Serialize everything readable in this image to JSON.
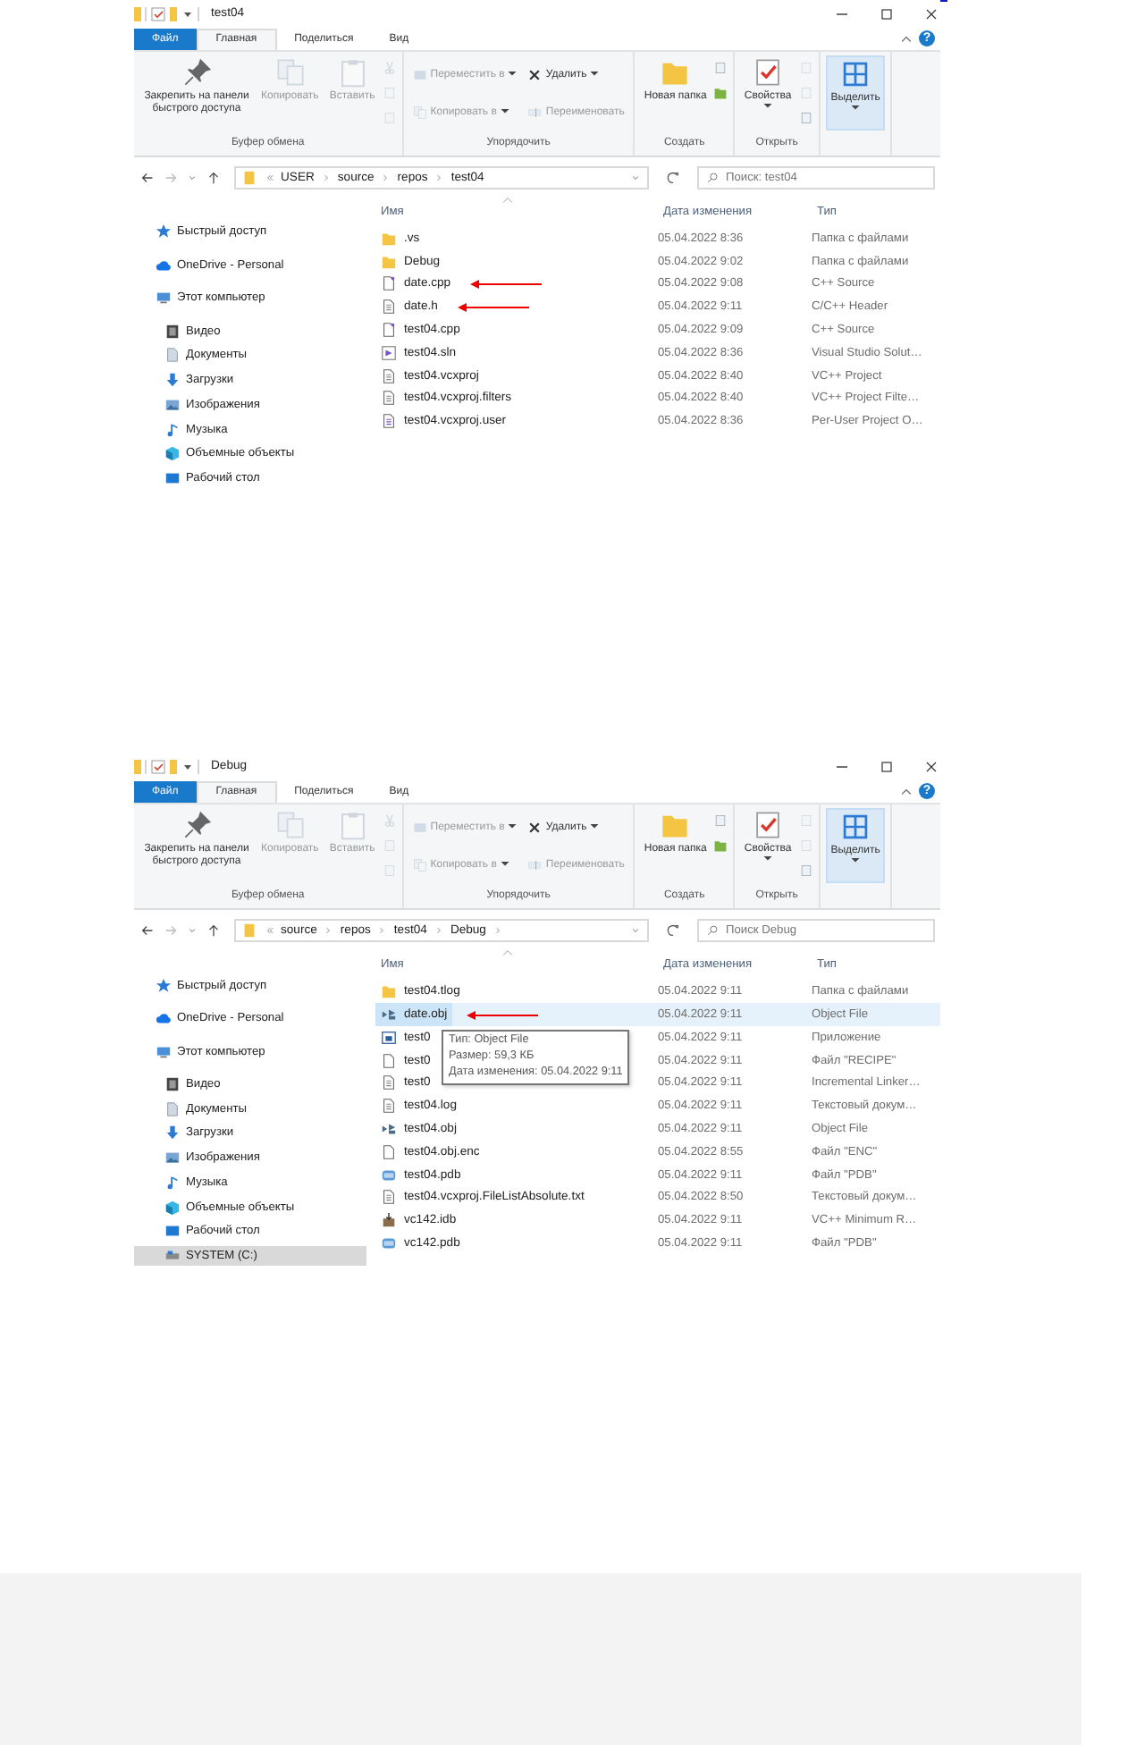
{
  "windows": [
    {
      "title": "test04",
      "help": "?",
      "tabs": [
        {
          "label": "Файл",
          "kind": "file",
          "selected": false
        },
        {
          "label": "Главная",
          "kind": "tab",
          "selected": true
        },
        {
          "label": "Поделиться",
          "kind": "tab",
          "selected": false
        },
        {
          "label": "Вид",
          "kind": "tab",
          "selected": false
        }
      ],
      "groups": [
        {
          "label": "Буфер обмена",
          "items": [
            {
              "kind": "large",
              "label": "Закрепить на панели быстрого доступа",
              "disabled": false
            },
            {
              "kind": "large",
              "label": "Копировать",
              "disabled": true
            },
            {
              "kind": "large",
              "label": "Вставить",
              "disabled": true
            },
            {
              "kind": "mini",
              "disabled": true
            },
            {
              "kind": "mini",
              "disabled": true
            },
            {
              "kind": "mini",
              "disabled": true
            }
          ]
        },
        {
          "label": "Упорядочить",
          "items": [
            {
              "kind": "small",
              "label": "Переместить в",
              "caret": true,
              "disabled": true
            },
            {
              "kind": "small",
              "label": "Копировать в",
              "caret": true,
              "disabled": true
            },
            {
              "kind": "small",
              "label": "Удалить",
              "caret": true,
              "disabled": false
            },
            {
              "kind": "small",
              "label": "Переименовать",
              "caret": false,
              "disabled": true
            }
          ]
        },
        {
          "label": "Создать",
          "items": [
            {
              "kind": "large",
              "label": "Новая папка",
              "disabled": false
            },
            {
              "kind": "mini",
              "disabled": false
            },
            {
              "kind": "mini",
              "disabled": false
            }
          ]
        },
        {
          "label": "Открыть",
          "items": [
            {
              "kind": "large",
              "label": "Свойства",
              "caret": true,
              "disabled": false
            },
            {
              "kind": "mini",
              "disabled": true
            },
            {
              "kind": "mini",
              "disabled": true
            },
            {
              "kind": "mini",
              "disabled": false
            }
          ]
        },
        {
          "items": [
            {
              "kind": "large",
              "label": "Выделить",
              "caret": true,
              "disabled": false
            }
          ]
        }
      ],
      "address": {
        "crumbs": [
          "USER",
          "source",
          "repos",
          "test04"
        ],
        "trailing": false
      },
      "search": {
        "placeholder": "Поиск: test04"
      },
      "nav": [
        {
          "label": "Быстрый доступ",
          "kind": "star",
          "selected": false
        },
        {
          "label": "OneDrive - Personal",
          "kind": "cloud",
          "selected": false
        },
        {
          "label": "Этот компьютер",
          "kind": "pc",
          "selected": false,
          "children": [
            {
              "label": "Видео",
              "kind": "video",
              "selected": false
            },
            {
              "label": "Документы",
              "kind": "docs",
              "selected": false
            },
            {
              "label": "Загрузки",
              "kind": "down",
              "selected": false
            },
            {
              "label": "Изображения",
              "kind": "images",
              "selected": false
            },
            {
              "label": "Музыка",
              "kind": "music",
              "selected": false
            },
            {
              "label": "Объемные объекты",
              "kind": "cube",
              "selected": false
            },
            {
              "label": "Рабочий стол",
              "kind": "desk",
              "selected": false
            }
          ]
        }
      ],
      "columns": [
        "Имя",
        "Дата изменения",
        "Тип"
      ],
      "rows": [
        {
          "name": ".vs",
          "date": "05.04.2022 8:36",
          "type": "Папка с файлами",
          "kind": "folder",
          "selected": false,
          "arrow": false
        },
        {
          "name": "Debug",
          "date": "05.04.2022 9:02",
          "type": "Папка с файлами",
          "kind": "folder",
          "selected": false,
          "arrow": false
        },
        {
          "name": "date.cpp",
          "date": "05.04.2022 9:08",
          "type": "C++ Source",
          "kind": "cpp",
          "selected": false,
          "arrow": true
        },
        {
          "name": "date.h",
          "date": "05.04.2022 9:11",
          "type": "C/C++ Header",
          "kind": "h",
          "selected": false,
          "arrow": true
        },
        {
          "name": "test04.cpp",
          "date": "05.04.2022 9:09",
          "type": "C++ Source",
          "kind": "cpp",
          "selected": false,
          "arrow": false
        },
        {
          "name": "test04.sln",
          "date": "05.04.2022 8:36",
          "type": "Visual Studio Solut…",
          "kind": "sln",
          "selected": false,
          "arrow": false
        },
        {
          "name": "test04.vcxproj",
          "date": "05.04.2022 8:40",
          "type": "VC++ Project",
          "kind": "proj",
          "selected": false,
          "arrow": false
        },
        {
          "name": "test04.vcxproj.filters",
          "date": "05.04.2022 8:40",
          "type": "VC++ Project Filte…",
          "kind": "h",
          "selected": false,
          "arrow": false
        },
        {
          "name": "test04.vcxproj.user",
          "date": "05.04.2022 8:36",
          "type": "Per-User Project O…",
          "kind": "user",
          "selected": false,
          "arrow": false
        }
      ]
    },
    {
      "title": "Debug",
      "help": "?",
      "tabs": [
        {
          "label": "Файл",
          "kind": "file",
          "selected": false
        },
        {
          "label": "Главная",
          "kind": "tab",
          "selected": true
        },
        {
          "label": "Поделиться",
          "kind": "tab",
          "selected": false
        },
        {
          "label": "Вид",
          "kind": "tab",
          "selected": false
        }
      ],
      "groups": [
        {
          "label": "Буфер обмена",
          "items": [
            {
              "kind": "large",
              "label": "Закрепить на панели быстрого доступа",
              "disabled": false
            },
            {
              "kind": "large",
              "label": "Копировать",
              "disabled": true
            },
            {
              "kind": "large",
              "label": "Вставить",
              "disabled": true
            },
            {
              "kind": "mini",
              "disabled": true
            },
            {
              "kind": "mini",
              "disabled": true
            },
            {
              "kind": "mini",
              "disabled": true
            }
          ]
        },
        {
          "label": "Упорядочить",
          "items": [
            {
              "kind": "small",
              "label": "Переместить в",
              "caret": true,
              "disabled": true
            },
            {
              "kind": "small",
              "label": "Копировать в",
              "caret": true,
              "disabled": true
            },
            {
              "kind": "small",
              "label": "Удалить",
              "caret": true,
              "disabled": false
            },
            {
              "kind": "small",
              "label": "Переименовать",
              "caret": false,
              "disabled": true
            }
          ]
        },
        {
          "label": "Создать",
          "items": [
            {
              "kind": "large",
              "label": "Новая папка",
              "disabled": false
            },
            {
              "kind": "mini",
              "disabled": false
            },
            {
              "kind": "mini",
              "disabled": false
            }
          ]
        },
        {
          "label": "Открыть",
          "items": [
            {
              "kind": "large",
              "label": "Свойства",
              "caret": true,
              "disabled": false
            },
            {
              "kind": "mini",
              "disabled": true
            },
            {
              "kind": "mini",
              "disabled": true
            },
            {
              "kind": "mini",
              "disabled": false
            }
          ]
        },
        {
          "items": [
            {
              "kind": "large",
              "label": "Выделить",
              "caret": true,
              "disabled": false
            }
          ]
        }
      ],
      "address": {
        "crumbs": [
          "source",
          "repos",
          "test04",
          "Debug"
        ],
        "trailing": true
      },
      "search": {
        "placeholder": "Поиск Debug"
      },
      "nav": [
        {
          "label": "Быстрый доступ",
          "kind": "star",
          "selected": false
        },
        {
          "label": "OneDrive - Personal",
          "kind": "cloud",
          "selected": false
        },
        {
          "label": "Этот компьютер",
          "kind": "pc",
          "selected": false,
          "children": [
            {
              "label": "Видео",
              "kind": "video",
              "selected": false
            },
            {
              "label": "Документы",
              "kind": "docs",
              "selected": false
            },
            {
              "label": "Загрузки",
              "kind": "down",
              "selected": false
            },
            {
              "label": "Изображения",
              "kind": "images",
              "selected": false
            },
            {
              "label": "Музыка",
              "kind": "music",
              "selected": false
            },
            {
              "label": "Объемные объекты",
              "kind": "cube",
              "selected": false
            },
            {
              "label": "Рабочий стол",
              "kind": "desk",
              "selected": false
            },
            {
              "label": "SYSTEM (C:)",
              "kind": "drive",
              "selected": true
            }
          ]
        }
      ],
      "columns": [
        "Имя",
        "Дата изменения",
        "Тип"
      ],
      "rows": [
        {
          "name": "test04.tlog",
          "date": "05.04.2022 9:11",
          "type": "Папка с файлами",
          "kind": "folder",
          "selected": false,
          "arrow": false
        },
        {
          "name": "date.obj",
          "date": "05.04.2022 9:11",
          "type": "Object File",
          "kind": "obj",
          "selected": true,
          "arrow": true
        },
        {
          "name": "test0",
          "date": "05.04.2022 9:11",
          "type": "Приложение",
          "kind": "exe",
          "selected": false,
          "arrow": false
        },
        {
          "name": "test0",
          "date": "05.04.2022 9:11",
          "type": "Файл \"RECIPE\"",
          "kind": "blank",
          "selected": false,
          "arrow": false
        },
        {
          "name": "test0",
          "date": "05.04.2022 9:11",
          "type": "Incremental Linker…",
          "kind": "ilk",
          "selected": false,
          "arrow": false
        },
        {
          "name": "test04.log",
          "date": "05.04.2022 9:11",
          "type": "Текстовый докум…",
          "kind": "text",
          "selected": false,
          "arrow": false
        },
        {
          "name": "test04.obj",
          "date": "05.04.2022 9:11",
          "type": "Object File",
          "kind": "obj",
          "selected": false,
          "arrow": false
        },
        {
          "name": "test04.obj.enc",
          "date": "05.04.2022 8:55",
          "type": "Файл \"ENC\"",
          "kind": "blank",
          "selected": false,
          "arrow": false
        },
        {
          "name": "test04.pdb",
          "date": "05.04.2022 9:11",
          "type": "Файл \"PDB\"",
          "kind": "pdb",
          "selected": false,
          "arrow": false
        },
        {
          "name": "test04.vcxproj.FileListAbsolute.txt",
          "date": "05.04.2022 8:50",
          "type": "Текстовый докум…",
          "kind": "text",
          "selected": false,
          "arrow": false
        },
        {
          "name": "vc142.idb",
          "date": "05.04.2022 9:11",
          "type": "VC++ Minimum R…",
          "kind": "idb",
          "selected": false,
          "arrow": false
        },
        {
          "name": "vc142.pdb",
          "date": "05.04.2022 9:11",
          "type": "Файл \"PDB\"",
          "kind": "pdb",
          "selected": false,
          "arrow": false
        }
      ],
      "tooltip": {
        "lines": [
          "Тип: Object File",
          "Размер: 59,3 КБ",
          "Дата изменения: 05.04.2022 9:11"
        ]
      }
    }
  ]
}
